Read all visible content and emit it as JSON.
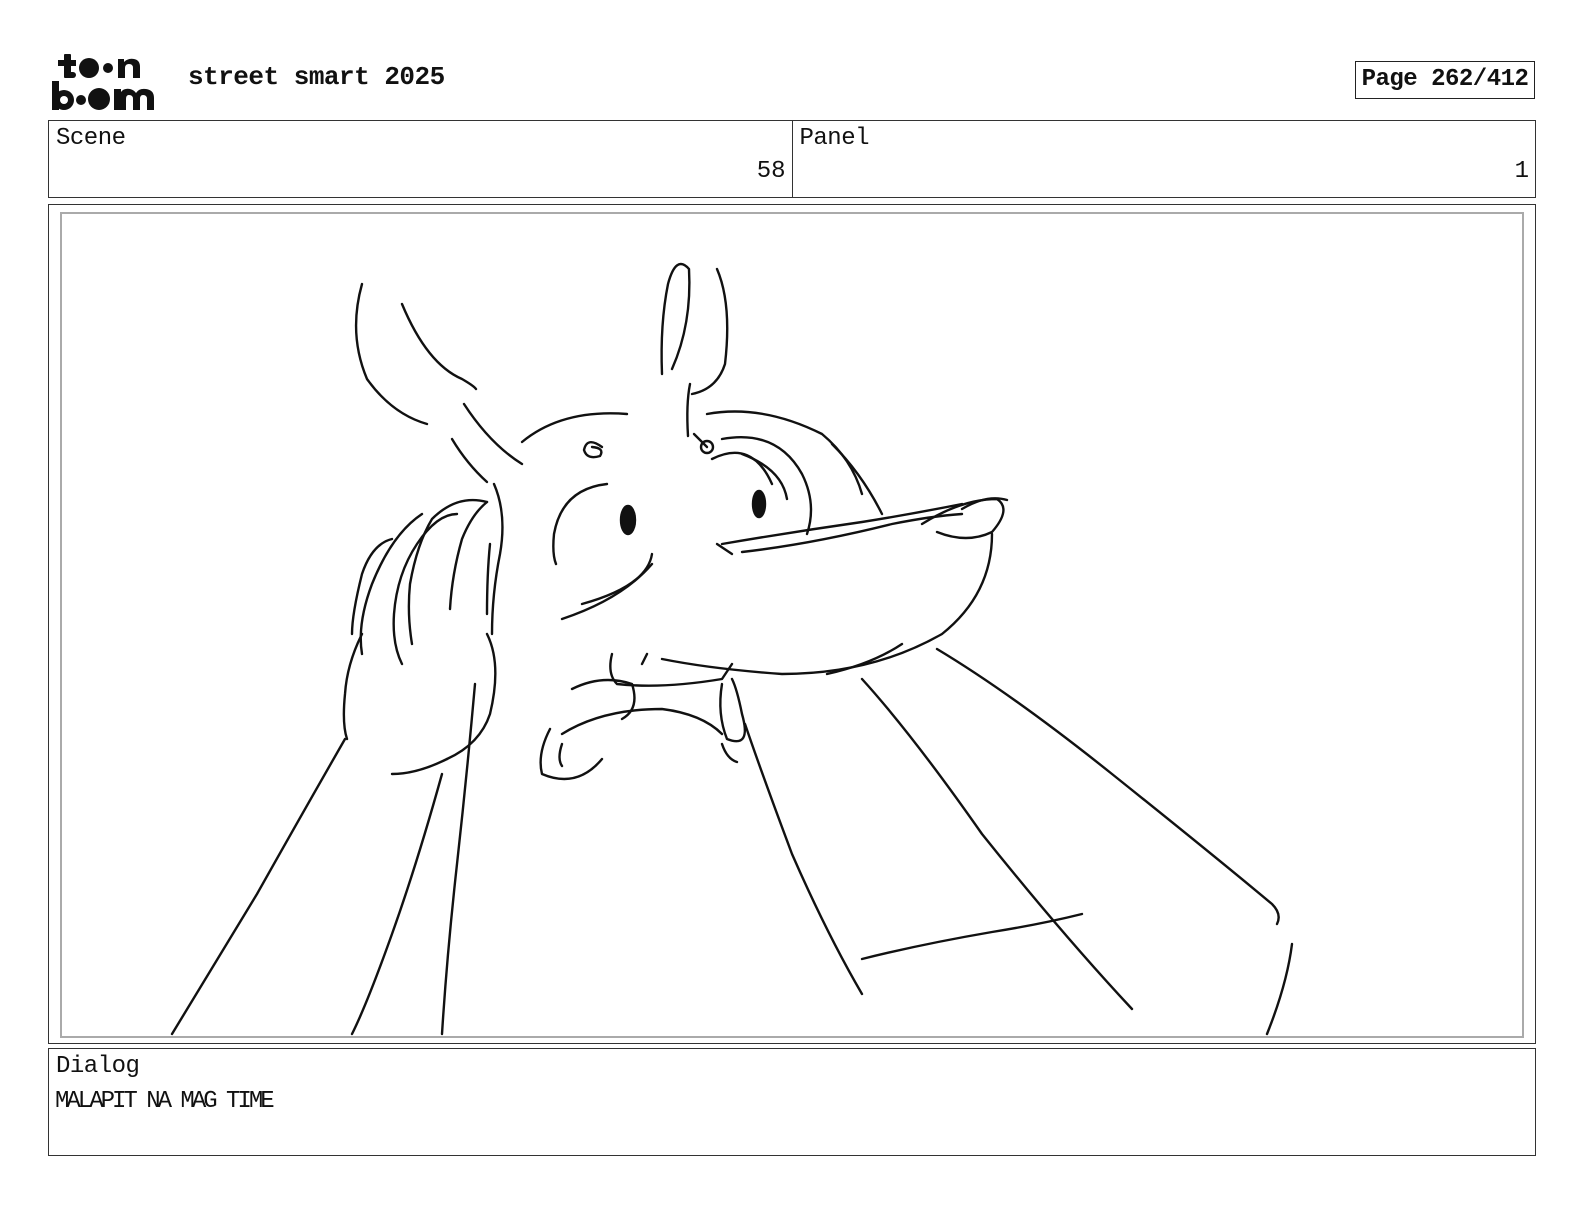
{
  "header": {
    "logo_name": "toon-boom-logo",
    "logo_text_top": "toon",
    "logo_text_bottom": "boom",
    "project_title": "street smart 2025",
    "page_label": "Page 262/412"
  },
  "info": {
    "scene_label": "Scene",
    "scene_value": "58",
    "panel_label": "Panel",
    "panel_value": "1"
  },
  "panel": {
    "drawing": "rough-pencil-sketch-character"
  },
  "dialog": {
    "label": "Dialog",
    "text": "MALAPIT NA MAG TIME"
  }
}
